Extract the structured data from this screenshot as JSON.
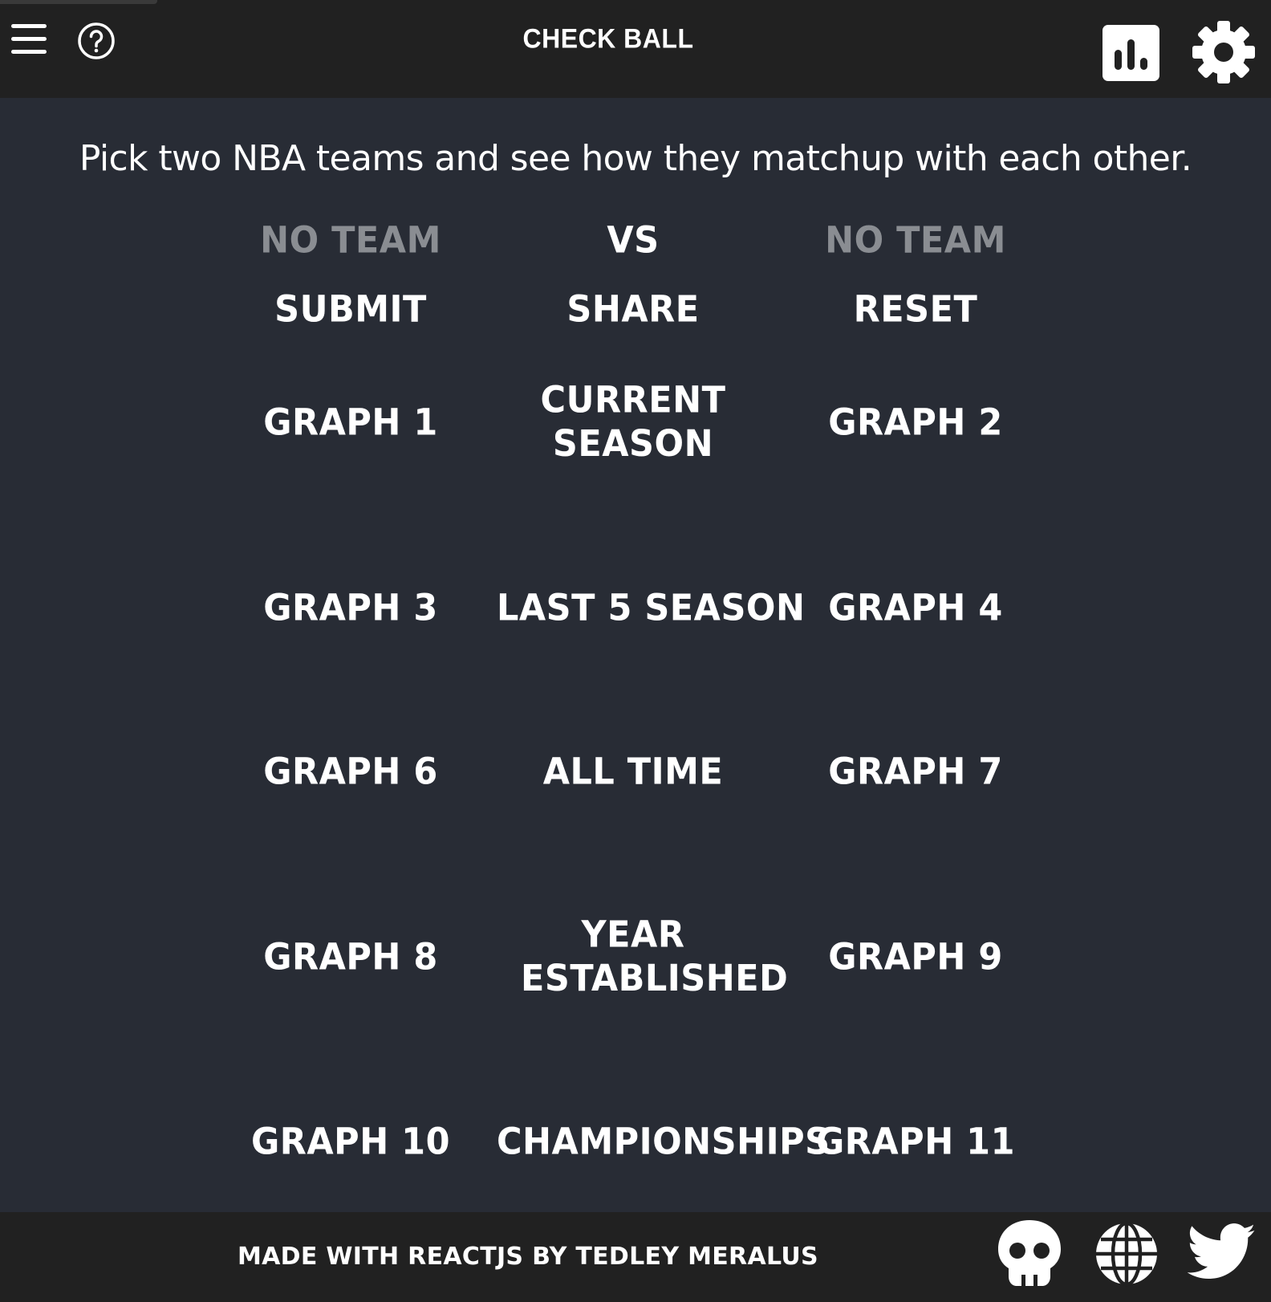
{
  "header": {
    "title": "CHECK BALL",
    "menu_icon": "menu-icon",
    "help_icon": "help-icon",
    "stats_icon": "bar-chart-icon",
    "settings_icon": "gear-icon"
  },
  "intro": "Pick two NBA teams and see how they matchup with each other.",
  "matchup": {
    "team_left": "NO TEAM",
    "vs": "VS",
    "team_right": "NO TEAM"
  },
  "actions": {
    "submit": "SUBMIT",
    "share": "SHARE",
    "reset": "RESET"
  },
  "rows": [
    {
      "left": "GRAPH 1",
      "label": "CURRENT SEASON",
      "right": "GRAPH 2"
    },
    {
      "left": "GRAPH 3",
      "label": "LAST 5 SEASON",
      "right": "GRAPH 4"
    },
    {
      "left": "GRAPH 6",
      "label": "ALL TIME",
      "right": "GRAPH 7"
    },
    {
      "left": "GRAPH 8",
      "label": "YEAR ESTABLISHED",
      "right": "GRAPH 9"
    },
    {
      "left": "GRAPH 10",
      "label": "CHAMPIONSHIPS",
      "right": "GRAPH 11"
    }
  ],
  "footer": {
    "credit": "MADE WITH REACTJS BY TEDLEY MERALUS",
    "icons": [
      "skull-icon",
      "globe-icon",
      "twitter-icon"
    ]
  },
  "colors": {
    "background": "#282c35",
    "bar": "#212121",
    "text": "#ffffff",
    "muted_text": "#8a8d92"
  }
}
